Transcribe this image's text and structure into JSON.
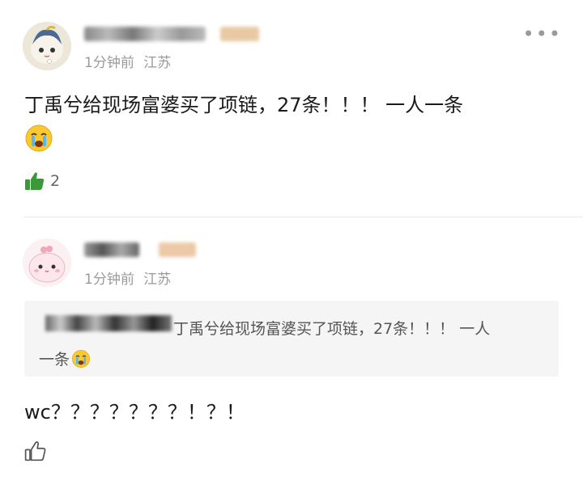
{
  "posts": [
    {
      "time": "1分钟前",
      "location": "江苏",
      "text": "丁禹兮给现场富婆买了项链，27条！！！ 一人一条",
      "likes": "2",
      "icons": [
        "crying-emoji",
        "thumbs-up-filled-icon",
        "more-icon"
      ]
    },
    {
      "time": "1分钟前",
      "location": "江苏",
      "quote_text_line1": "丁禹兮给现场富婆买了项链，27条！！！ 一人",
      "quote_text_line2": "一条",
      "text": "wc？？？？？？？！？！",
      "icons": [
        "crying-emoji",
        "thumbs-up-outline-icon"
      ]
    }
  ],
  "colors": {
    "like_green": "#3a9a3a",
    "meta_gray": "#9a9a9a",
    "quote_bg": "#f5f5f5"
  }
}
